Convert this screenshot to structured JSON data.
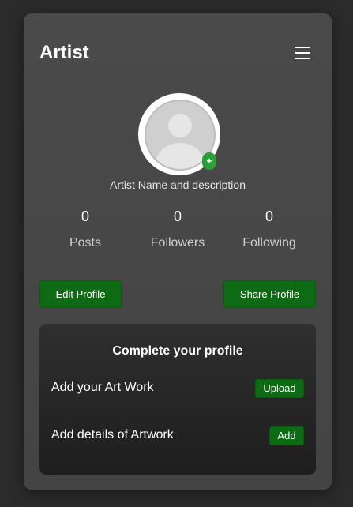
{
  "header": {
    "title": "Artist",
    "menu_icon": "hamburger-menu-icon"
  },
  "profile": {
    "avatar_icon": "default-user-avatar-icon",
    "add_photo_symbol": "+",
    "description": "Artist Name and description"
  },
  "stats": [
    {
      "value": "0",
      "label": "Posts"
    },
    {
      "value": "0",
      "label": "Followers"
    },
    {
      "value": "0",
      "label": "Following"
    }
  ],
  "actions": {
    "edit_label": "Edit Profile",
    "share_label": "Share Profile"
  },
  "complete_profile": {
    "title": "Complete your profile",
    "tasks": [
      {
        "label": "Add your Art Work",
        "button": "Upload"
      },
      {
        "label": "Add details of Artwork",
        "button": "Add"
      }
    ]
  },
  "colors": {
    "background": "#2b2b2b",
    "card": "#484848",
    "accent_green": "#0c6b13",
    "badge_green": "#2e9e3b",
    "panel": "#252525"
  }
}
